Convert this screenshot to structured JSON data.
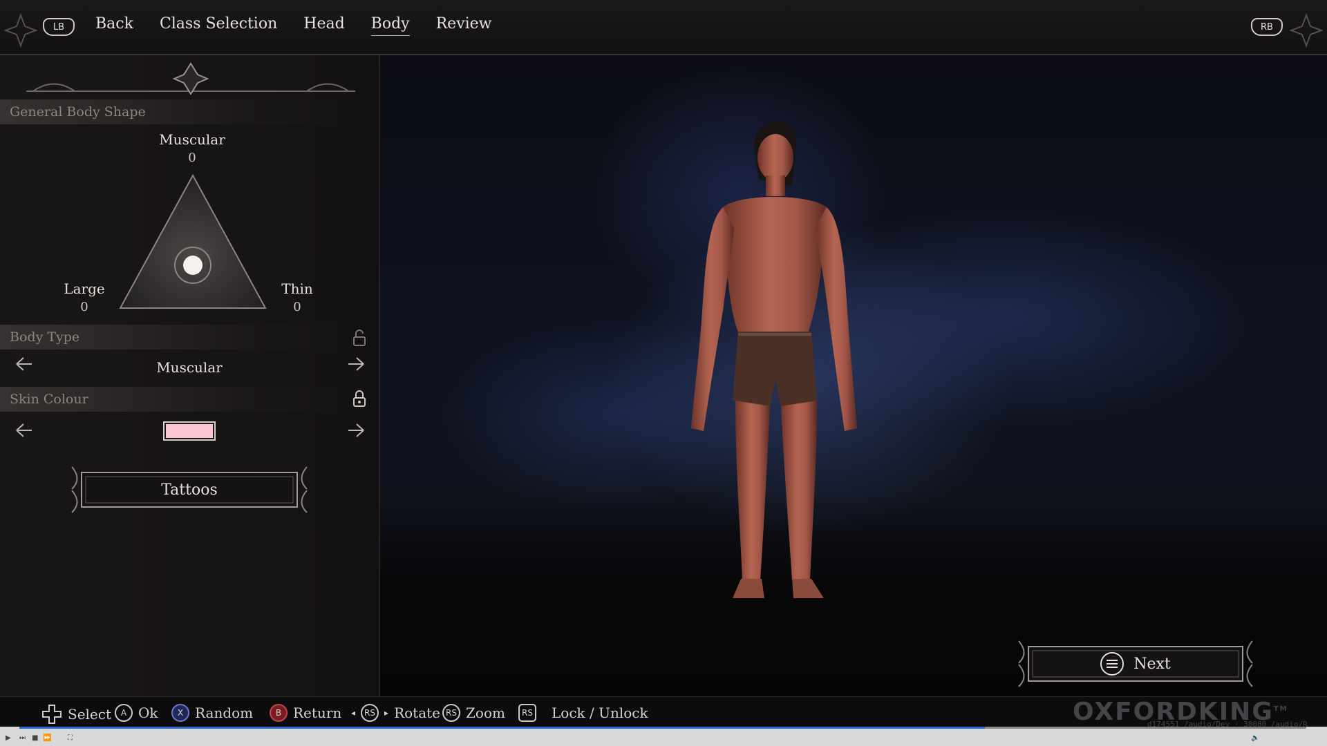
{
  "nav": {
    "left_bumper": "LB",
    "right_bumper": "RB",
    "tabs": [
      "Back",
      "Class Selection",
      "Head",
      "Body",
      "Review"
    ],
    "active_tab": "Body"
  },
  "panel": {
    "body_shape": {
      "header": "General Body Shape",
      "top_label": "Muscular",
      "top_value": "0",
      "left_label": "Large",
      "left_value": "0",
      "right_label": "Thin",
      "right_value": "0"
    },
    "body_type": {
      "header": "Body Type",
      "value": "Muscular",
      "locked": false
    },
    "skin_colour": {
      "header": "Skin Colour",
      "swatch_color": "#f8c7d0",
      "locked": true
    },
    "tattoos_button": "Tattoos"
  },
  "next_button": "Next",
  "hints": {
    "select": "Select",
    "ok": "Ok",
    "ok_key": "A",
    "random": "Random",
    "random_key": "X",
    "return": "Return",
    "return_key": "B",
    "rotate": "Rotate",
    "rotate_key": "RS",
    "zoom": "Zoom",
    "zoom_key": "RS",
    "lock": "Lock / Unlock",
    "lock_key": "RS"
  },
  "watermark": {
    "brand": "OXFORDKING",
    "tm": "TM",
    "sub": "d174551 /audio/Dev · 30080 /audio/R"
  },
  "player": {
    "progress": 0.75
  },
  "colors": {
    "accent_text": "#e6e2dc",
    "muted_header": "#8d8680",
    "swatch": "#f8c7d0",
    "b_button": "#7a1b22",
    "x_button": "#20285a"
  }
}
